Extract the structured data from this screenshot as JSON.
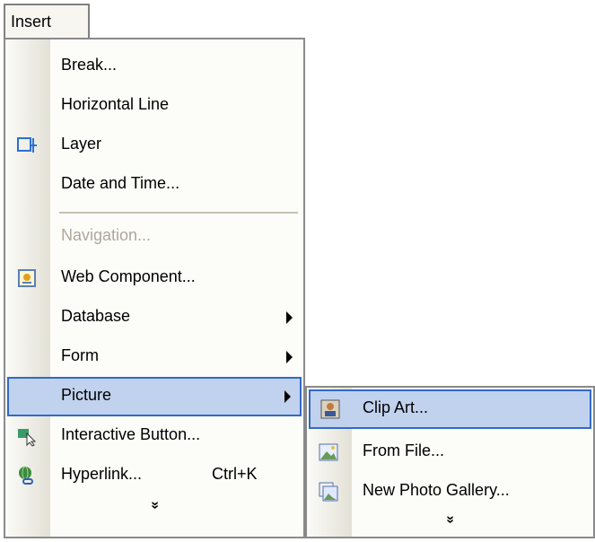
{
  "menubar": {
    "insert_label": "Insert"
  },
  "main_menu": {
    "break": "Break...",
    "horizontal_line": "Horizontal Line",
    "layer": "Layer",
    "date_time": "Date and Time...",
    "navigation": "Navigation...",
    "web_component": "Web Component...",
    "database": "Database",
    "form": "Form",
    "picture": "Picture",
    "interactive_button": "Interactive Button...",
    "hyperlink": "Hyperlink...",
    "hyperlink_shortcut": "Ctrl+K",
    "expand": "»"
  },
  "picture_submenu": {
    "clip_art": "Clip Art...",
    "from_file": "From File...",
    "new_photo_gallery": "New Photo Gallery...",
    "expand": "»"
  },
  "colors": {
    "highlight_bg": "#c1d2ee",
    "highlight_border": "#316ac5",
    "disabled_text": "#aca899"
  }
}
